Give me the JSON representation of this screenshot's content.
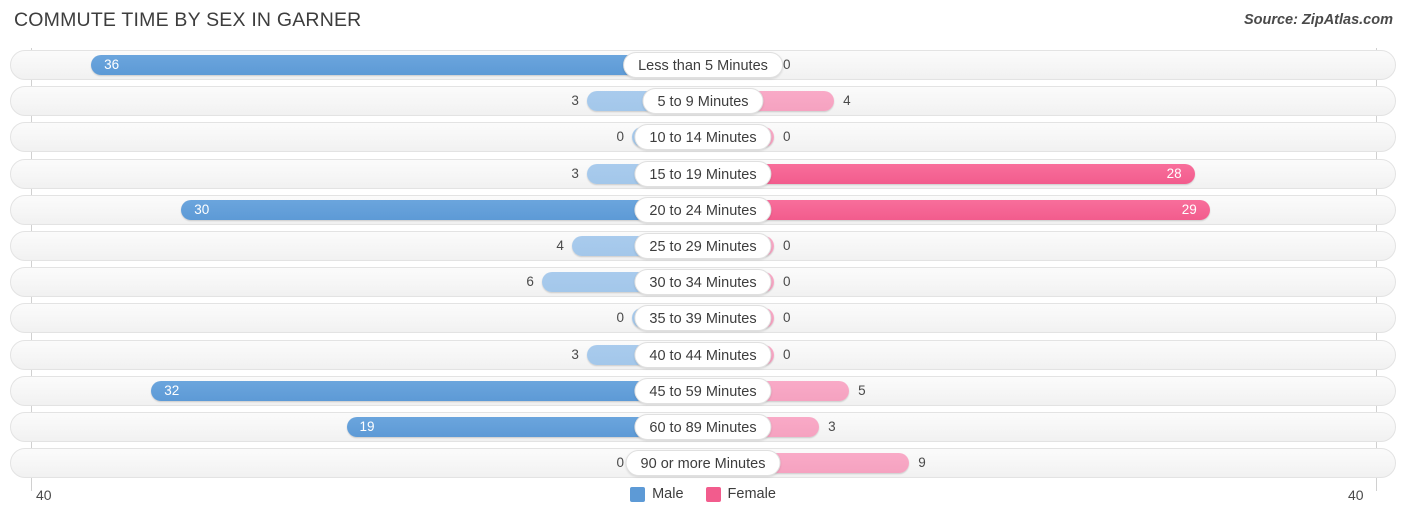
{
  "header": {
    "title": "COMMUTE TIME BY SEX IN GARNER",
    "source": "Source: ZipAtlas.com"
  },
  "legend": {
    "items": [
      {
        "label": "Male",
        "color": "#5d9ad6"
      },
      {
        "label": "Female",
        "color": "#f25c8d"
      }
    ]
  },
  "axis": {
    "left_end": "40",
    "right_end": "40",
    "max": 40
  },
  "colors": {
    "male_light": "#a8cbec",
    "male_dark": "#5d9ad6",
    "female_light": "#f7a6c3",
    "female_dark": "#f25c8d",
    "track": "#f5f5f5",
    "axis": "#d0d0d0"
  },
  "chart_data": {
    "type": "bar",
    "title": "COMMUTE TIME BY SEX IN GARNER",
    "subtitle": "",
    "orientation": "horizontal-diverging",
    "xlabel": "",
    "ylabel": "",
    "xlim": [
      0,
      40
    ],
    "grid": false,
    "legend_position": "bottom-center",
    "categories": [
      "Less than 5 Minutes",
      "5 to 9 Minutes",
      "10 to 14 Minutes",
      "15 to 19 Minutes",
      "20 to 24 Minutes",
      "25 to 29 Minutes",
      "30 to 34 Minutes",
      "35 to 39 Minutes",
      "40 to 44 Minutes",
      "45 to 59 Minutes",
      "60 to 89 Minutes",
      "90 or more Minutes"
    ],
    "series": [
      {
        "name": "Male",
        "values": [
          36,
          3,
          0,
          3,
          30,
          4,
          6,
          0,
          3,
          32,
          19,
          0
        ],
        "labels": [
          "36",
          "3",
          "0",
          "3",
          "30",
          "4",
          "6",
          "0",
          "3",
          "32",
          "19",
          "0"
        ]
      },
      {
        "name": "Female",
        "values": [
          0,
          4,
          0,
          28,
          29,
          0,
          0,
          0,
          0,
          5,
          3,
          9
        ],
        "labels": [
          "0",
          "4",
          "0",
          "28",
          "29",
          "0",
          "0",
          "0",
          "0",
          "5",
          "3",
          "9"
        ]
      }
    ]
  }
}
